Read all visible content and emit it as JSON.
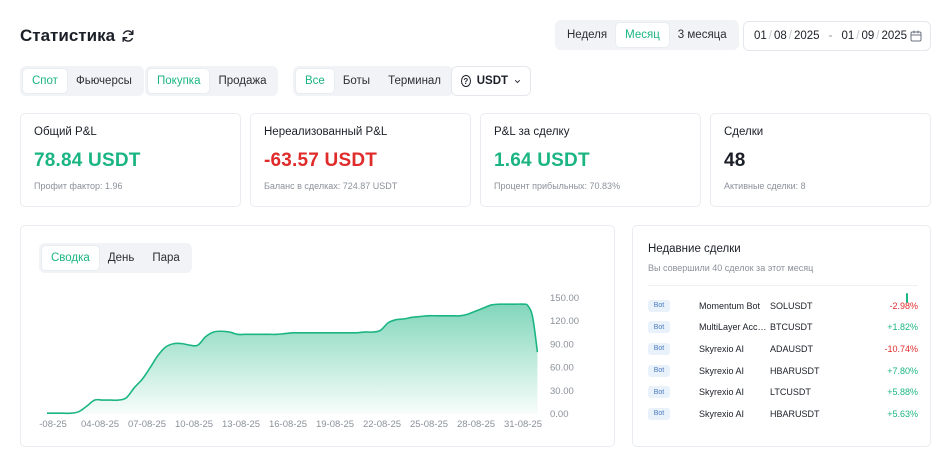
{
  "header": {
    "title": "Статистика"
  },
  "period_tabs": [
    {
      "label": "Неделя",
      "active": false
    },
    {
      "label": "Месяц",
      "active": true
    },
    {
      "label": "3 месяца",
      "active": false
    }
  ],
  "date_range": {
    "from_day": "01",
    "from_month": "08",
    "from_year": "2025",
    "to_day": "01",
    "to_month": "09",
    "to_year": "2025"
  },
  "filters": {
    "market": [
      {
        "label": "Спот",
        "active": true
      },
      {
        "label": "Фьючерсы",
        "active": false
      }
    ],
    "side": [
      {
        "label": "Покупка",
        "active": true
      },
      {
        "label": "Продажа",
        "active": false
      }
    ],
    "source": [
      {
        "label": "Все",
        "active": true
      },
      {
        "label": "Боты",
        "active": false
      },
      {
        "label": "Терминал",
        "active": false
      }
    ],
    "currency": "USDT"
  },
  "cards": [
    {
      "label": "Общий P&L",
      "value": "78.84 USDT",
      "sub": "Профит фактор: 1.96",
      "tone": "green"
    },
    {
      "label": "Нереализованный P&L",
      "value": "-63.57 USDT",
      "sub": "Баланс в сделках: 724.87 USDT",
      "tone": "red"
    },
    {
      "label": "P&L за сделку",
      "value": "1.64 USDT",
      "sub": "Процент прибыльных: 70.83%",
      "tone": "green"
    },
    {
      "label": "Сделки",
      "value": "48",
      "sub": "Активные сделки: 8",
      "tone": "dark"
    }
  ],
  "chart_tabs": [
    {
      "label": "Сводка",
      "active": true
    },
    {
      "label": "День",
      "active": false
    },
    {
      "label": "Пара",
      "active": false
    }
  ],
  "chart_data": {
    "type": "area",
    "x_labels": [
      "-08-25",
      "04-08-25",
      "07-08-25",
      "10-08-25",
      "13-08-25",
      "16-08-25",
      "19-08-25",
      "22-08-25",
      "25-08-25",
      "28-08-25",
      "31-08-25"
    ],
    "y_ticks": [
      "150.00",
      "120.00",
      "90.00",
      "60.00",
      "30.00",
      "0.00"
    ],
    "ylim": [
      0,
      150
    ],
    "x": [
      0,
      0.5,
      1,
      1.5,
      2,
      2.5,
      3,
      3.5,
      4,
      4.5,
      5,
      5.5,
      6,
      6.5,
      7,
      7.5,
      8,
      8.5,
      9,
      9.5,
      10,
      10.5,
      11,
      11.5,
      12,
      12.5,
      13,
      13.5,
      14,
      14.5,
      15,
      15.5,
      16,
      16.5,
      17,
      17.5,
      18,
      18.5,
      19,
      19.5,
      20,
      20.5,
      21,
      21.5,
      22,
      22.5,
      23,
      23.5,
      24,
      24.5,
      25,
      25.5,
      26,
      26.5,
      27,
      27.5,
      28,
      28.5,
      29,
      29.5,
      30,
      30.3,
      30.6,
      30.9
    ],
    "values": [
      1,
      1,
      1,
      1,
      3,
      10,
      18,
      18,
      18,
      18,
      21,
      34,
      45,
      60,
      76,
      87,
      91,
      91,
      89,
      89,
      100,
      106,
      107,
      106,
      103,
      103,
      103,
      103,
      103,
      103,
      104,
      105,
      105,
      105,
      105,
      105,
      105,
      105,
      105,
      105,
      106,
      106,
      108,
      118,
      122,
      123,
      125,
      126,
      127,
      127,
      127,
      127,
      127,
      129,
      133,
      137,
      141,
      142,
      142,
      142,
      142,
      140,
      125,
      80
    ],
    "line_color": "#1bb583",
    "fill_color_top": "#1bb583"
  },
  "recent_trades": {
    "title": "Недавние сделки",
    "subtitle": "Вы совершили 40 сделок за этот месяц",
    "rows": [
      {
        "badge": "Bot",
        "name": "Momentum Bot",
        "pair": "SOLUSDT",
        "pnl": "-2.98%",
        "tone": "red"
      },
      {
        "badge": "Bot",
        "name": "MultiLayer Accumulator",
        "pair": "BTCUSDT",
        "pnl": "+1.82%",
        "tone": "green"
      },
      {
        "badge": "Bot",
        "name": "Skyrexio AI",
        "pair": "ADAUSDT",
        "pnl": "-10.74%",
        "tone": "red"
      },
      {
        "badge": "Bot",
        "name": "Skyrexio AI",
        "pair": "HBARUSDT",
        "pnl": "+7.80%",
        "tone": "green"
      },
      {
        "badge": "Bot",
        "name": "Skyrexio AI",
        "pair": "LTCUSDT",
        "pnl": "+5.88%",
        "tone": "green"
      },
      {
        "badge": "Bot",
        "name": "Skyrexio AI",
        "pair": "HBARUSDT",
        "pnl": "+5.63%",
        "tone": "green"
      }
    ]
  }
}
